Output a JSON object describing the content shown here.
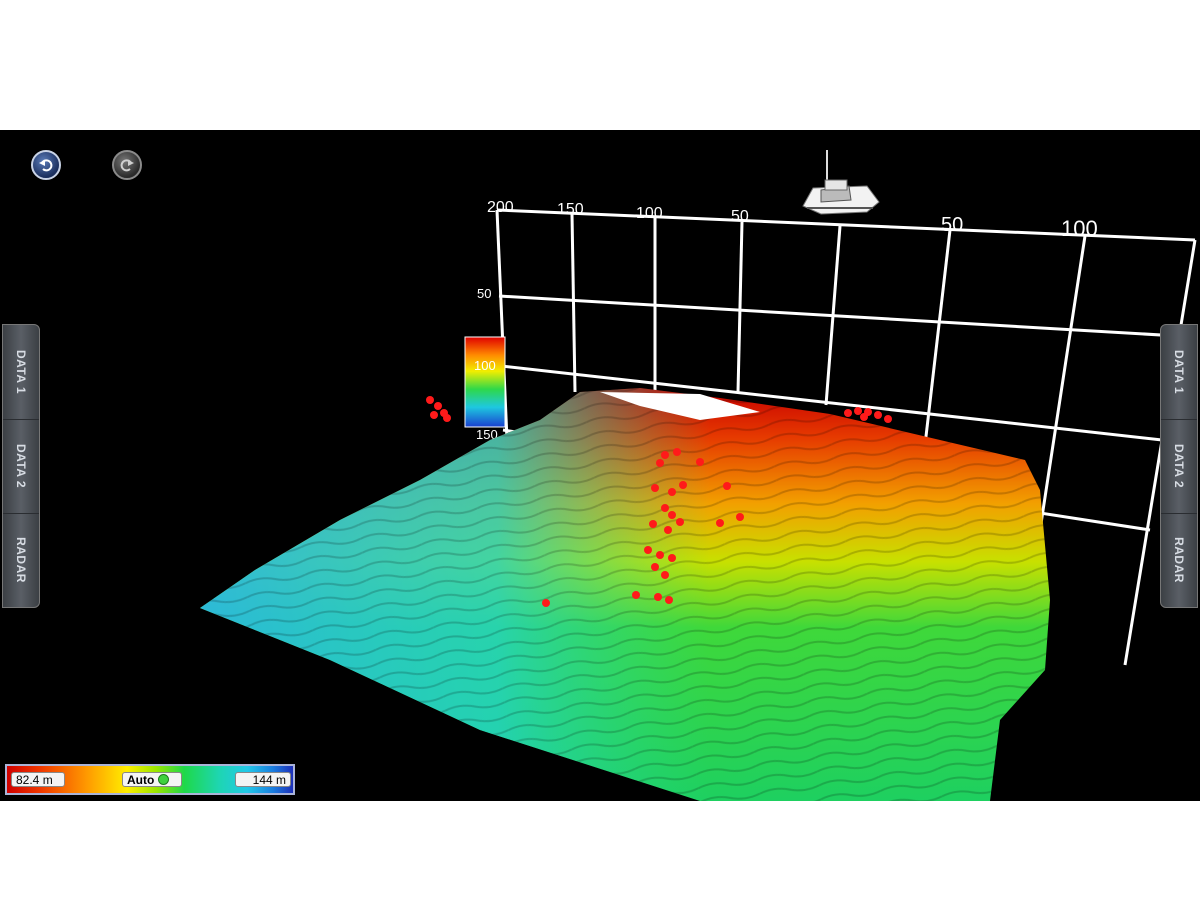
{
  "toolbar": {
    "undo_icon": "undo-icon",
    "redo_icon": "redo-icon"
  },
  "left_panel": {
    "tabs": [
      "DATA 1",
      "DATA 2",
      "RADAR"
    ]
  },
  "right_panel": {
    "tabs": [
      "DATA 1",
      "DATA 2",
      "RADAR"
    ]
  },
  "grid": {
    "top_left_labels": [
      "200",
      "150",
      "100",
      "50"
    ],
    "top_right_labels": [
      "50",
      "100"
    ],
    "depth_labels": [
      "50"
    ]
  },
  "depth_scale": {
    "labels": [
      "100",
      "150"
    ],
    "colors": [
      "#e00000",
      "#ff9a00",
      "#f2ee00",
      "#2ed84a",
      "#1ec8e0",
      "#1a3fd0"
    ]
  },
  "legend": {
    "min_label": "82.4 m",
    "mode_label": "Auto",
    "max_label": "144 m"
  },
  "boat_icon": "boat-icon",
  "colors": {
    "shallow": "#d00000",
    "mid": "#1ed84a",
    "deep": "#1d2fb8",
    "fish_targets": "#ff1a1a"
  }
}
